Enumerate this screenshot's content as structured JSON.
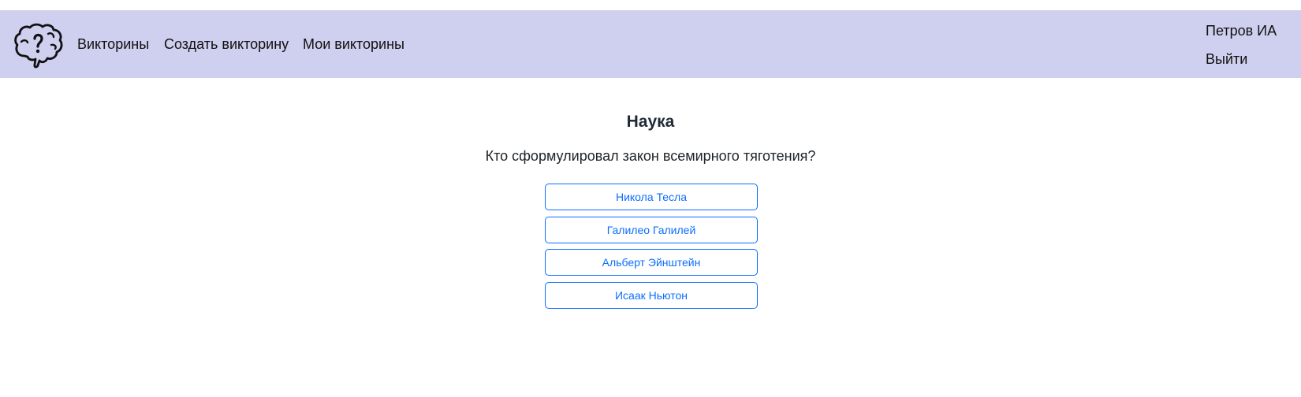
{
  "nav": {
    "logo_icon": "brain-question-icon",
    "links": [
      "Викторины",
      "Создать викторину",
      "Мои викторины"
    ],
    "user_name": "Петров ИА",
    "logout_label": "Выйти",
    "background_color": "#cfcfef"
  },
  "quiz": {
    "title": "Наука",
    "question": "Кто сформулировал закон всемирного тяготения?",
    "answers": [
      "Никола Тесла",
      "Галилео Галилей",
      "Альберт Эйнштейн",
      "Исаак Ньютон"
    ],
    "accent_color": "#0d6efd"
  }
}
